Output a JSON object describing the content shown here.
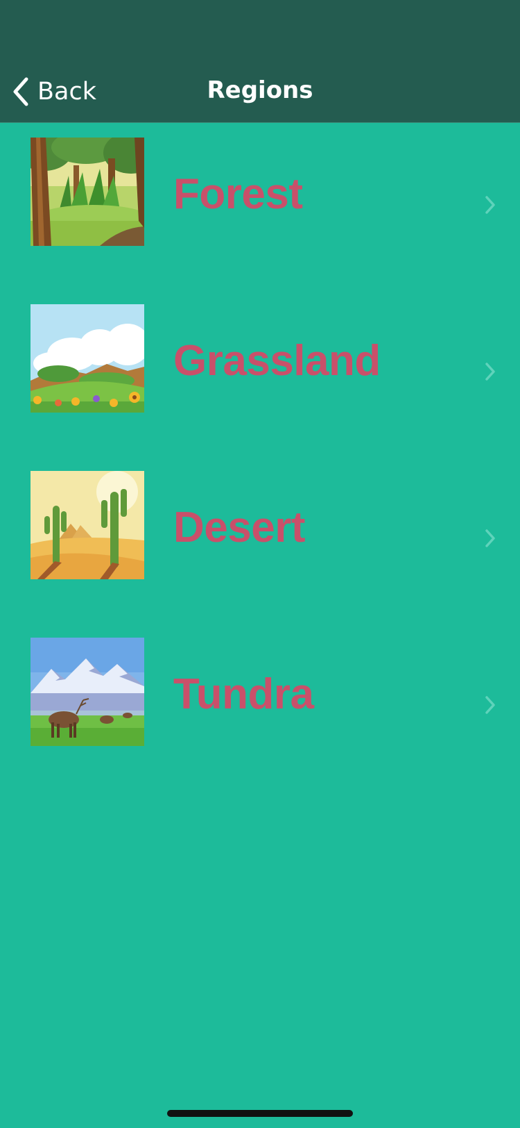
{
  "navbar": {
    "back_label": "Back",
    "title": "Regions"
  },
  "colors": {
    "background": "#1dbb9a",
    "navbar": "#245c50",
    "label": "#c9506a",
    "chevron": "#5fd3bb"
  },
  "regions": [
    {
      "label": "Forest",
      "image": "forest-illustration"
    },
    {
      "label": "Grassland",
      "image": "grassland-illustration"
    },
    {
      "label": "Desert",
      "image": "desert-illustration"
    },
    {
      "label": "Tundra",
      "image": "tundra-illustration"
    }
  ]
}
